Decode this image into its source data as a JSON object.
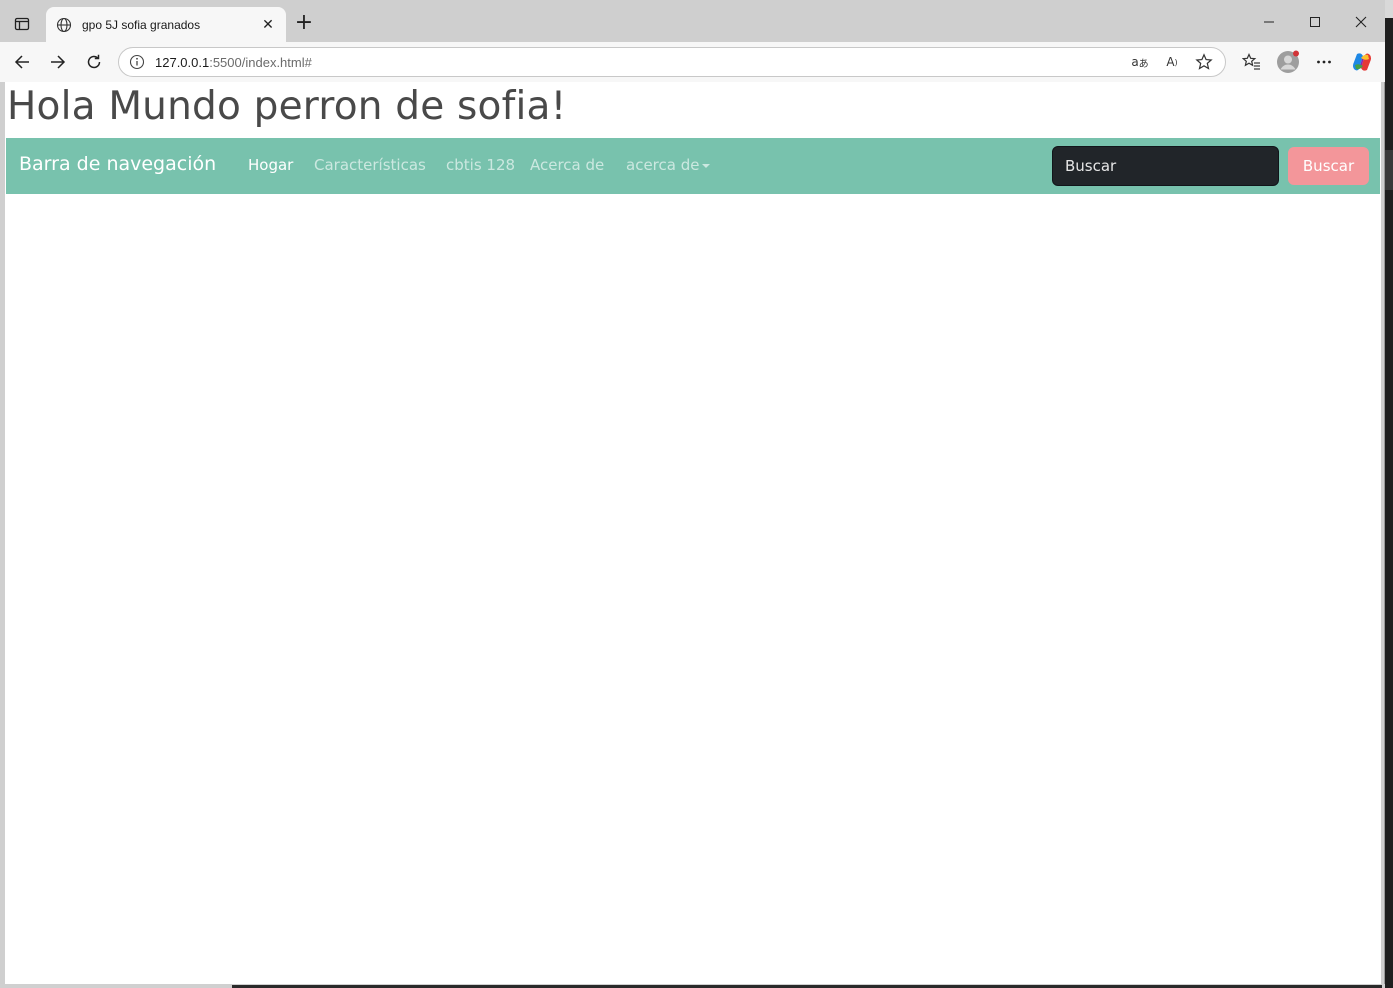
{
  "browser": {
    "tab": {
      "title": "gpo 5J sofia granados"
    },
    "address": {
      "host": "127.0.0.1",
      "path": ":5500/index.html#"
    },
    "colors": {
      "chrome": "#cfcfcf",
      "toolbar": "#f7f7f7",
      "avatar_dot": "#d13438"
    }
  },
  "page": {
    "heading": "Hola Mundo perron de sofia!",
    "navbar": {
      "brand": "Barra de navegación",
      "links": [
        "Hogar",
        "Características",
        "cbtis 128",
        "Acerca de"
      ],
      "dropdown_label": "acerca de",
      "search_placeholder": "Buscar",
      "search_button": "Buscar"
    },
    "colors": {
      "navbar": "#78c2ad",
      "button": "#f3969a",
      "input": "#212529",
      "heading": "#494949"
    }
  }
}
